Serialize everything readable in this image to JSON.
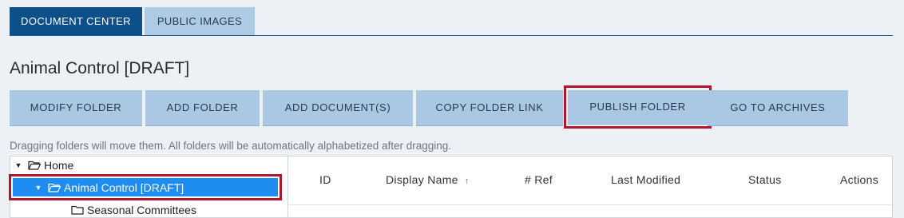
{
  "tabs": [
    {
      "label": "DOCUMENT CENTER",
      "active": true
    },
    {
      "label": "PUBLIC IMAGES",
      "active": false
    }
  ],
  "page_title": "Animal Control [DRAFT]",
  "toolbar": {
    "buttons": [
      {
        "label": "MODIFY FOLDER"
      },
      {
        "label": "ADD FOLDER"
      },
      {
        "label": "ADD DOCUMENT(S)"
      },
      {
        "label": "COPY FOLDER LINK"
      },
      {
        "label": "PUBLISH FOLDER",
        "highlighted": true
      },
      {
        "label": "GO TO ARCHIVES"
      }
    ]
  },
  "hint": "Dragging folders will move them. All folders will be automatically alphabetized after dragging.",
  "tree": {
    "items": [
      {
        "label": "Home",
        "expanded": true,
        "icon": "folder-open-icon"
      },
      {
        "label": "Animal Control [DRAFT]",
        "expanded": true,
        "selected": true,
        "icon": "folder-open-icon"
      },
      {
        "label": "Seasonal Committees",
        "icon": "folder-icon"
      }
    ]
  },
  "grid": {
    "columns": [
      {
        "label": "ID"
      },
      {
        "label": "Display Name",
        "sort": "↑"
      },
      {
        "label": "# Ref"
      },
      {
        "label": "Last Modified"
      },
      {
        "label": "Status"
      },
      {
        "label": "Actions"
      }
    ]
  },
  "colors": {
    "tab_active": "#0d4f8a",
    "button_bg": "#aac8e4",
    "highlight_border": "#b0172c",
    "selection": "#1e8cf0"
  }
}
